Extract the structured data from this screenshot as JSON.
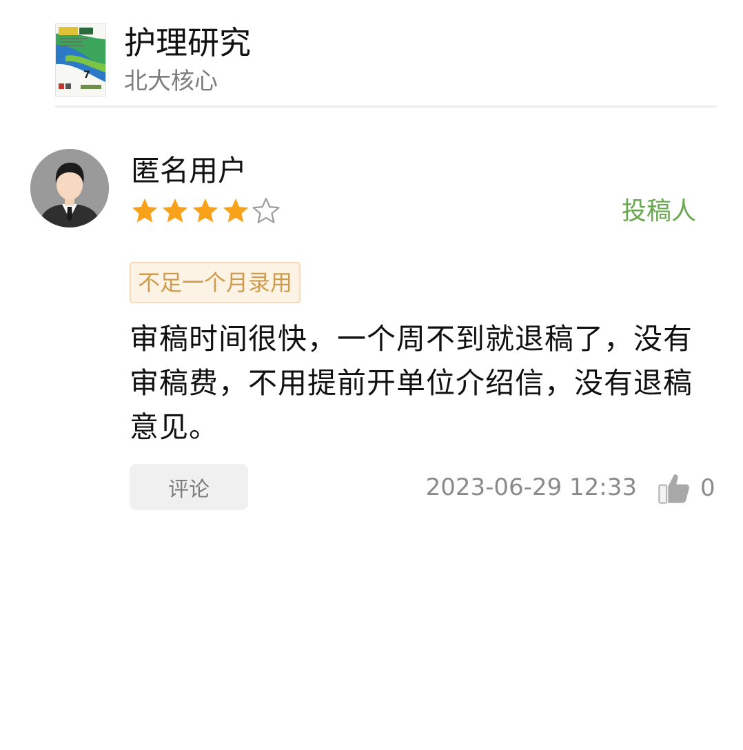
{
  "journal": {
    "title": "护理研究",
    "subtitle": "北大核心",
    "cover_icon": "journal-cover-thumbnail"
  },
  "review": {
    "user_name": "匿名用户",
    "avatar_icon": "anonymous-user-avatar",
    "rating": 4,
    "rating_max": 5,
    "role": "投稿人",
    "decision": "不足一个月录用",
    "content": "审稿时间很快，一个周不到就退稿了，没有审稿费，不用提前开单位介绍信，没有退稿意见。",
    "comment_label": "评论",
    "time": "2023-06-29 12:33",
    "like_icon": "thumbs-up-icon",
    "like_count": "0"
  },
  "colors": {
    "star_filled": "#f7a21a",
    "star_empty": "#9b9b9b",
    "role": "#6aa84f",
    "decision_text": "#cf9b4c",
    "decision_bg": "#fdf3e5",
    "meta_gray": "#8a8a8a"
  }
}
